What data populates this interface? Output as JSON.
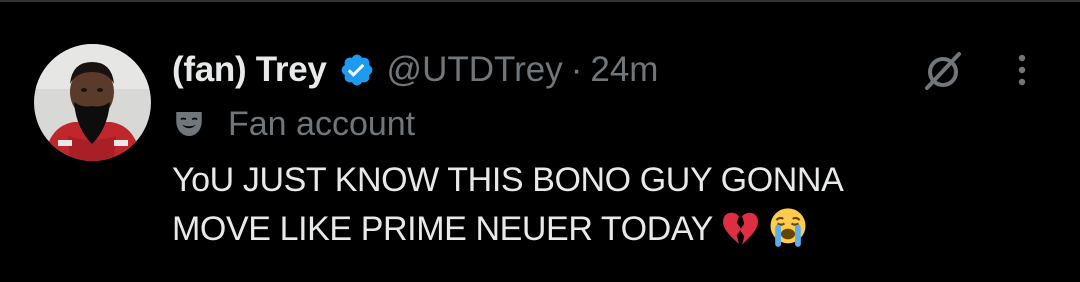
{
  "tweet": {
    "display_name": "(fan) Trey",
    "handle": "@UTDTrey",
    "separator": "·",
    "time": "24m",
    "label_text": "Fan account",
    "text_line1": "YoU JUST KNOW THIS BONO GUY GONNA",
    "text_line2": "MOVE LIKE PRIME NEUER TODAY",
    "emojis": [
      "broken-heart",
      "loudly-crying-face"
    ],
    "verified": true
  },
  "icons": {
    "verified_badge": "verified-badge-icon",
    "fan_label": "theater-mask-icon",
    "grok": "grok-icon",
    "more": "more-vertical-icon"
  },
  "colors": {
    "background": "#000000",
    "primary_text": "#e7e9ea",
    "secondary_text": "#71767b",
    "verified": "#1d9bf0",
    "divider": "#2f3336"
  }
}
